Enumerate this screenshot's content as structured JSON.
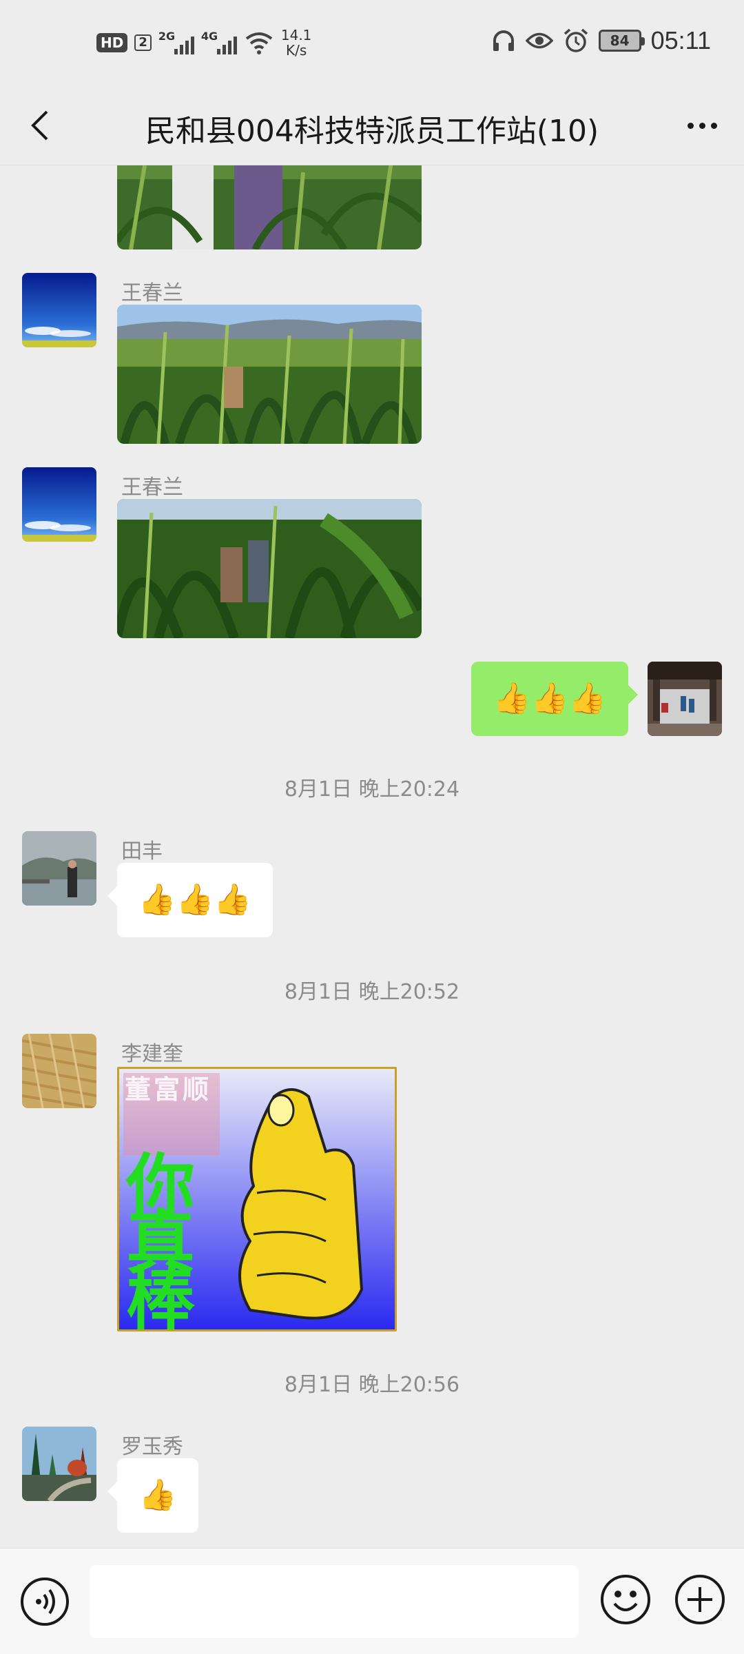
{
  "status_bar": {
    "hd": "HD",
    "sim": "2",
    "net1": "2G",
    "net2": "4G",
    "speed_value": "14.1",
    "speed_unit": "K/s",
    "battery": "84",
    "time": "05:11"
  },
  "header": {
    "title": "民和县004科技特派员工作站(10)"
  },
  "messages": [
    {
      "type": "image",
      "sender": "",
      "content": "corn-field-photo"
    },
    {
      "type": "image",
      "sender": "王春兰",
      "content": "corn-field-photo"
    },
    {
      "type": "image",
      "sender": "王春兰",
      "content": "corn-field-photo"
    },
    {
      "type": "emoji",
      "sender": "me",
      "content": "👍👍👍"
    },
    {
      "type": "timestamp",
      "text": "8月1日 晚上20:24"
    },
    {
      "type": "emoji",
      "sender": "田丰",
      "content": "👍👍👍"
    },
    {
      "type": "timestamp",
      "text": "8月1日 晚上20:52"
    },
    {
      "type": "sticker",
      "sender": "李建奎",
      "stamp_text": "董富顺",
      "text": "你真棒"
    },
    {
      "type": "timestamp",
      "text": "8月1日 晚上20:56"
    },
    {
      "type": "emoji",
      "sender": "罗玉秀",
      "content": "👍"
    }
  ],
  "input_bar": {
    "text_value": ""
  },
  "colors": {
    "background": "#ededed",
    "my_bubble": "#95ec69",
    "their_bubble": "#ffffff",
    "sticker_text": "#22dd22"
  }
}
